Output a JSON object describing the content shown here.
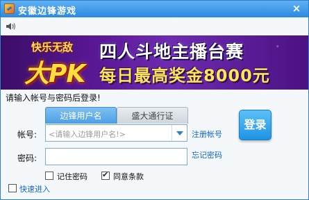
{
  "window": {
    "title": "安徽边锋游戏",
    "close_glyph": "×"
  },
  "icons": {
    "app": "game-logo-icon",
    "sound": "speaker-icon",
    "dropdown": "chevron-down-icon"
  },
  "banner": {
    "badge_top": "快乐无敌",
    "badge_main": "大PK",
    "headline1": "四人斗地主播台赛",
    "headline2": "每日最高奖金8000元"
  },
  "login": {
    "prompt": "请输入帐号与密码后登录!",
    "tabs": [
      {
        "label": "边锋用户名",
        "active": true
      },
      {
        "label": "盛大通行证",
        "active": false
      }
    ],
    "account_label": "帐号:",
    "account_placeholder": "<请输入边锋用户名!>",
    "password_label": "密码:",
    "register_link": "注册帐号",
    "forgot_link": "忘记密码",
    "login_button": "登录",
    "remember_password": {
      "label": "记住密码",
      "checked": false
    },
    "agree_terms": {
      "label": "同意条款",
      "checked": true
    },
    "quick_enter": {
      "label": "快速进入",
      "checked": false
    }
  },
  "colors": {
    "title_bar": "#2c8ae0",
    "link": "#1466c6",
    "button": "#1e93e4",
    "banner_bg": "#5a1897"
  }
}
